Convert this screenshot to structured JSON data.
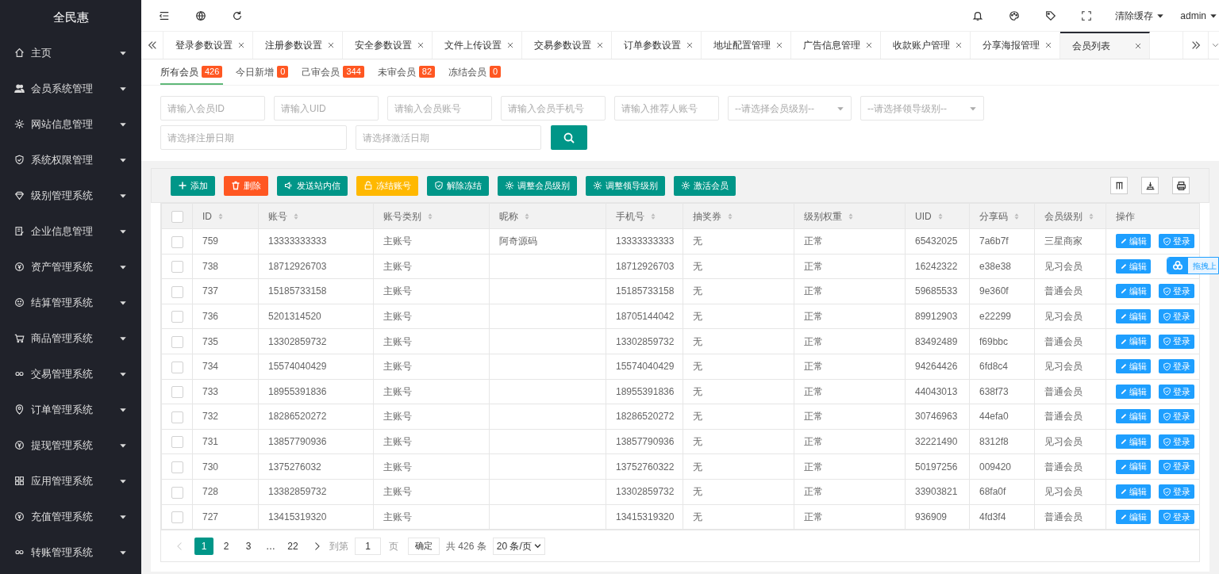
{
  "sidebar": {
    "logo": "全民惠",
    "items": [
      "主页",
      "会员系统管理",
      "网站信息管理",
      "系统权限管理",
      "级别管理系统",
      "企业信息管理",
      "资产管理系统",
      "结算管理系统",
      "商品管理系统",
      "交易管理系统",
      "订单管理系统",
      "提现管理系统",
      "应用管理系统",
      "充值管理系统",
      "转账管理系统"
    ]
  },
  "header": {
    "clear_cache": "清除缓存",
    "user": "admin"
  },
  "tabs": [
    {
      "label": "登录参数设置",
      "selected": false
    },
    {
      "label": "注册参数设置",
      "selected": false
    },
    {
      "label": "安全参数设置",
      "selected": false
    },
    {
      "label": "文件上传设置",
      "selected": false
    },
    {
      "label": "交易参数设置",
      "selected": false
    },
    {
      "label": "订单参数设置",
      "selected": false
    },
    {
      "label": "地址配置管理",
      "selected": false
    },
    {
      "label": "广告信息管理",
      "selected": false
    },
    {
      "label": "收款账户管理",
      "selected": false
    },
    {
      "label": "分享海报管理",
      "selected": false
    },
    {
      "label": "会员列表",
      "selected": true
    }
  ],
  "filter_tabs": [
    {
      "label": "所有会员",
      "count": "426",
      "selected": true
    },
    {
      "label": "今日新增",
      "count": "0",
      "selected": false
    },
    {
      "label": "己审会员",
      "count": "344",
      "selected": false
    },
    {
      "label": "未审会员",
      "count": "82",
      "selected": false
    },
    {
      "label": "冻结会员",
      "count": "0",
      "selected": false
    }
  ],
  "search_fields": [
    {
      "placeholder": "请输入会员ID",
      "kind": "input"
    },
    {
      "placeholder": "请输入UID",
      "kind": "input"
    },
    {
      "placeholder": "请输入会员账号",
      "kind": "input"
    },
    {
      "placeholder": "请输入会员手机号",
      "kind": "input"
    },
    {
      "placeholder": "请输入推荐人账号",
      "kind": "input"
    },
    {
      "placeholder": "--请选择会员级别--",
      "kind": "select"
    },
    {
      "placeholder": "--请选择领导级别--",
      "kind": "select"
    },
    {
      "placeholder": "请选择注册日期",
      "kind": "date"
    },
    {
      "placeholder": "请选择激活日期",
      "kind": "date"
    }
  ],
  "toolbar": [
    {
      "label": "添加",
      "color": "#009688"
    },
    {
      "label": "删除",
      "color": "#ff5722"
    },
    {
      "label": "发送站内信",
      "color": "#009688"
    },
    {
      "label": "冻结账号",
      "color": "#ffb800"
    },
    {
      "label": "解除冻结",
      "color": "#009688"
    },
    {
      "label": "调整会员级别",
      "color": "#009688"
    },
    {
      "label": "调整领导级别",
      "color": "#009688"
    },
    {
      "label": "激活会员",
      "color": "#009688"
    }
  ],
  "table": {
    "header_checked": false,
    "columns": [
      "ID",
      "账号",
      "账号类别",
      "昵称",
      "手机号",
      "抽奖券",
      "级别权重",
      "UID",
      "分享码",
      "会员级别",
      "操作"
    ],
    "rows": [
      {
        "checked": false,
        "cells": [
          "759",
          "13333333333",
          "主账号",
          "阿奇源码",
          "13333333333",
          "无",
          "正常",
          "65432025",
          "7a6b7f",
          "三星商家"
        ],
        "actions": [
          "编辑",
          "登录"
        ]
      },
      {
        "checked": false,
        "cells": [
          "738",
          "18712926703",
          "主账号",
          "",
          "18712926703",
          "无",
          "正常",
          "16242322",
          "e38e38",
          "见习会员"
        ],
        "actions": [
          "编辑"
        ]
      },
      {
        "checked": false,
        "cells": [
          "737",
          "15185733158",
          "主账号",
          "",
          "15185733158",
          "无",
          "正常",
          "59685533",
          "9e360f",
          "普通会员"
        ],
        "actions": [
          "编辑",
          "登录"
        ]
      },
      {
        "checked": false,
        "cells": [
          "736",
          "5201314520",
          "主账号",
          "",
          "18705144042",
          "无",
          "正常",
          "89912903",
          "e22299",
          "见习会员"
        ],
        "actions": [
          "编辑",
          "登录"
        ]
      },
      {
        "checked": false,
        "cells": [
          "735",
          "13302859732",
          "主账号",
          "",
          "13302859732",
          "无",
          "正常",
          "83492489",
          "f69bbc",
          "普通会员"
        ],
        "actions": [
          "编辑",
          "登录"
        ]
      },
      {
        "checked": false,
        "cells": [
          "734",
          "15574040429",
          "主账号",
          "",
          "15574040429",
          "无",
          "正常",
          "94264426",
          "6fd8c4",
          "见习会员"
        ],
        "actions": [
          "编辑",
          "登录"
        ]
      },
      {
        "checked": false,
        "cells": [
          "733",
          "18955391836",
          "主账号",
          "",
          "18955391836",
          "无",
          "正常",
          "44043013",
          "638f73",
          "普通会员"
        ],
        "actions": [
          "编辑",
          "登录"
        ]
      },
      {
        "checked": false,
        "cells": [
          "732",
          "18286520272",
          "主账号",
          "",
          "18286520272",
          "无",
          "正常",
          "30746963",
          "44efa0",
          "普通会员"
        ],
        "actions": [
          "编辑",
          "登录"
        ]
      },
      {
        "checked": false,
        "cells": [
          "731",
          "13857790936",
          "主账号",
          "",
          "13857790936",
          "无",
          "正常",
          "32221490",
          "8312f8",
          "见习会员"
        ],
        "actions": [
          "编辑",
          "登录"
        ]
      },
      {
        "checked": false,
        "cells": [
          "730",
          "1375276032",
          "主账号",
          "",
          "13752760322",
          "无",
          "正常",
          "50197256",
          "009420",
          "普通会员"
        ],
        "actions": [
          "编辑",
          "登录"
        ]
      },
      {
        "checked": false,
        "cells": [
          "728",
          "13382859732",
          "主账号",
          "",
          "13302859732",
          "无",
          "正常",
          "33903821",
          "68fa0f",
          "见习会员"
        ],
        "actions": [
          "编辑",
          "登录"
        ]
      },
      {
        "checked": false,
        "cells": [
          "727",
          "13415319320",
          "主账号",
          "",
          "13415319320",
          "无",
          "正常",
          "936909",
          "4fd3f4",
          "普通会员"
        ],
        "actions": [
          "编辑",
          "登录"
        ]
      }
    ]
  },
  "drag_widget": {
    "label": "拖拽上"
  },
  "pagination": {
    "pages": [
      {
        "label": "1",
        "selected": true
      },
      {
        "label": "2",
        "selected": false
      },
      {
        "label": "3",
        "selected": false
      },
      {
        "label": "…",
        "selected": false
      },
      {
        "label": "22",
        "selected": false
      }
    ],
    "goto_label": "到第",
    "goto_value": "1",
    "page_unit": "页",
    "confirm": "确定",
    "total": "共 426 条",
    "page_size": "20 条/页"
  }
}
